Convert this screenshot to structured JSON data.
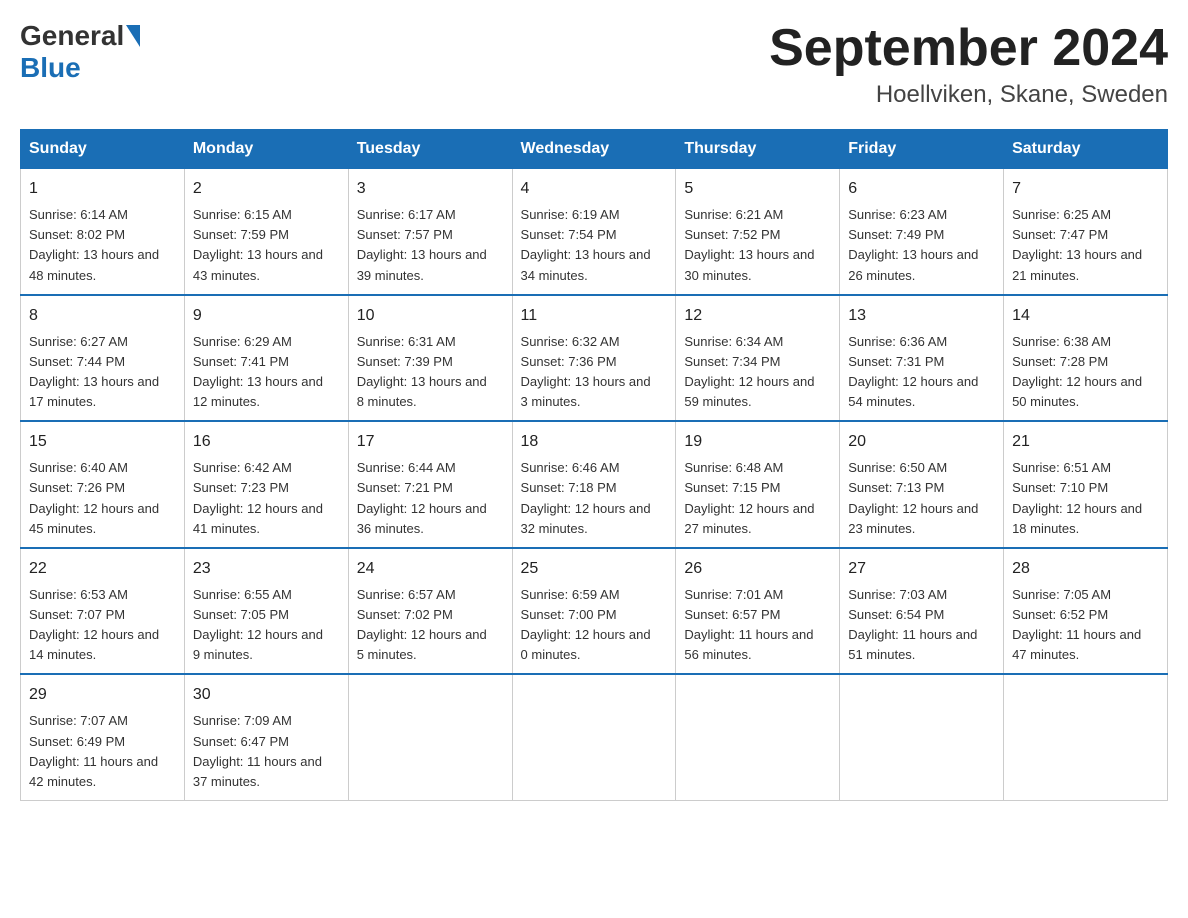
{
  "header": {
    "logo_general": "General",
    "logo_blue": "Blue",
    "month_title": "September 2024",
    "location": "Hoellviken, Skane, Sweden"
  },
  "days_of_week": [
    "Sunday",
    "Monday",
    "Tuesday",
    "Wednesday",
    "Thursday",
    "Friday",
    "Saturday"
  ],
  "weeks": [
    [
      {
        "day": "1",
        "sunrise": "6:14 AM",
        "sunset": "8:02 PM",
        "daylight": "13 hours and 48 minutes."
      },
      {
        "day": "2",
        "sunrise": "6:15 AM",
        "sunset": "7:59 PM",
        "daylight": "13 hours and 43 minutes."
      },
      {
        "day": "3",
        "sunrise": "6:17 AM",
        "sunset": "7:57 PM",
        "daylight": "13 hours and 39 minutes."
      },
      {
        "day": "4",
        "sunrise": "6:19 AM",
        "sunset": "7:54 PM",
        "daylight": "13 hours and 34 minutes."
      },
      {
        "day": "5",
        "sunrise": "6:21 AM",
        "sunset": "7:52 PM",
        "daylight": "13 hours and 30 minutes."
      },
      {
        "day": "6",
        "sunrise": "6:23 AM",
        "sunset": "7:49 PM",
        "daylight": "13 hours and 26 minutes."
      },
      {
        "day": "7",
        "sunrise": "6:25 AM",
        "sunset": "7:47 PM",
        "daylight": "13 hours and 21 minutes."
      }
    ],
    [
      {
        "day": "8",
        "sunrise": "6:27 AM",
        "sunset": "7:44 PM",
        "daylight": "13 hours and 17 minutes."
      },
      {
        "day": "9",
        "sunrise": "6:29 AM",
        "sunset": "7:41 PM",
        "daylight": "13 hours and 12 minutes."
      },
      {
        "day": "10",
        "sunrise": "6:31 AM",
        "sunset": "7:39 PM",
        "daylight": "13 hours and 8 minutes."
      },
      {
        "day": "11",
        "sunrise": "6:32 AM",
        "sunset": "7:36 PM",
        "daylight": "13 hours and 3 minutes."
      },
      {
        "day": "12",
        "sunrise": "6:34 AM",
        "sunset": "7:34 PM",
        "daylight": "12 hours and 59 minutes."
      },
      {
        "day": "13",
        "sunrise": "6:36 AM",
        "sunset": "7:31 PM",
        "daylight": "12 hours and 54 minutes."
      },
      {
        "day": "14",
        "sunrise": "6:38 AM",
        "sunset": "7:28 PM",
        "daylight": "12 hours and 50 minutes."
      }
    ],
    [
      {
        "day": "15",
        "sunrise": "6:40 AM",
        "sunset": "7:26 PM",
        "daylight": "12 hours and 45 minutes."
      },
      {
        "day": "16",
        "sunrise": "6:42 AM",
        "sunset": "7:23 PM",
        "daylight": "12 hours and 41 minutes."
      },
      {
        "day": "17",
        "sunrise": "6:44 AM",
        "sunset": "7:21 PM",
        "daylight": "12 hours and 36 minutes."
      },
      {
        "day": "18",
        "sunrise": "6:46 AM",
        "sunset": "7:18 PM",
        "daylight": "12 hours and 32 minutes."
      },
      {
        "day": "19",
        "sunrise": "6:48 AM",
        "sunset": "7:15 PM",
        "daylight": "12 hours and 27 minutes."
      },
      {
        "day": "20",
        "sunrise": "6:50 AM",
        "sunset": "7:13 PM",
        "daylight": "12 hours and 23 minutes."
      },
      {
        "day": "21",
        "sunrise": "6:51 AM",
        "sunset": "7:10 PM",
        "daylight": "12 hours and 18 minutes."
      }
    ],
    [
      {
        "day": "22",
        "sunrise": "6:53 AM",
        "sunset": "7:07 PM",
        "daylight": "12 hours and 14 minutes."
      },
      {
        "day": "23",
        "sunrise": "6:55 AM",
        "sunset": "7:05 PM",
        "daylight": "12 hours and 9 minutes."
      },
      {
        "day": "24",
        "sunrise": "6:57 AM",
        "sunset": "7:02 PM",
        "daylight": "12 hours and 5 minutes."
      },
      {
        "day": "25",
        "sunrise": "6:59 AM",
        "sunset": "7:00 PM",
        "daylight": "12 hours and 0 minutes."
      },
      {
        "day": "26",
        "sunrise": "7:01 AM",
        "sunset": "6:57 PM",
        "daylight": "11 hours and 56 minutes."
      },
      {
        "day": "27",
        "sunrise": "7:03 AM",
        "sunset": "6:54 PM",
        "daylight": "11 hours and 51 minutes."
      },
      {
        "day": "28",
        "sunrise": "7:05 AM",
        "sunset": "6:52 PM",
        "daylight": "11 hours and 47 minutes."
      }
    ],
    [
      {
        "day": "29",
        "sunrise": "7:07 AM",
        "sunset": "6:49 PM",
        "daylight": "11 hours and 42 minutes."
      },
      {
        "day": "30",
        "sunrise": "7:09 AM",
        "sunset": "6:47 PM",
        "daylight": "11 hours and 37 minutes."
      },
      null,
      null,
      null,
      null,
      null
    ]
  ],
  "labels": {
    "sunrise": "Sunrise:",
    "sunset": "Sunset:",
    "daylight": "Daylight:"
  }
}
